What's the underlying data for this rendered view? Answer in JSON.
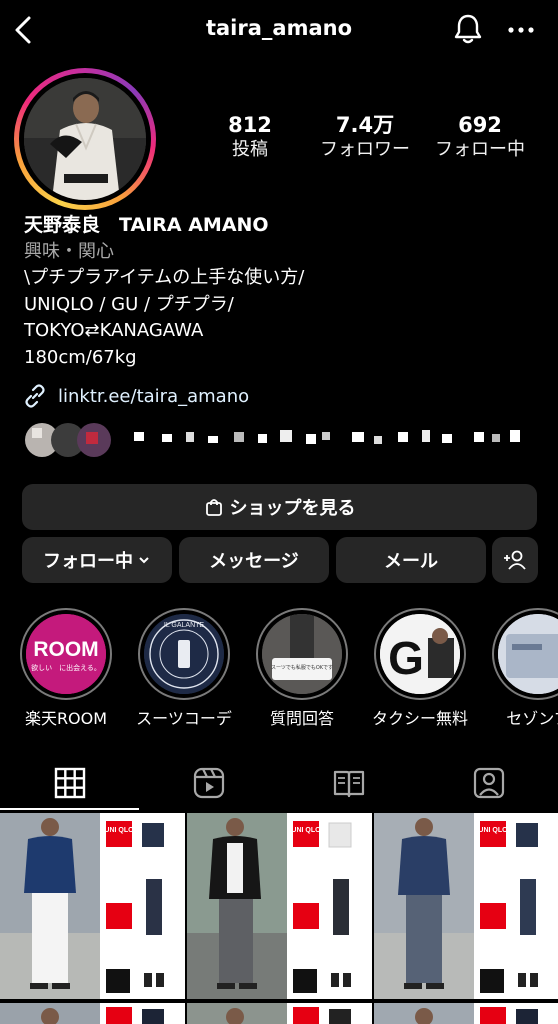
{
  "header": {
    "username": "taira_amano"
  },
  "stats": [
    {
      "num": "812",
      "label": "投稿"
    },
    {
      "num": "7.4万",
      "label": "フォロワー"
    },
    {
      "num": "692",
      "label": "フォロー中"
    }
  ],
  "bio": {
    "name": "天野泰良　TAIRA AMANO",
    "category": "興味・関心",
    "lines": [
      "\\プチプラアイテムの上手な使い方/",
      "UNIQLO / GU / プチプラ/",
      "TOKYO⇄KANAGAWA",
      "180cm/67kg"
    ],
    "link": "linktr.ee/taira_amano"
  },
  "buttons": {
    "shop": "ショップを見る",
    "following": "フォロー中",
    "message": "メッセージ",
    "mail": "メール"
  },
  "highlights": [
    {
      "label": "楽天ROOM",
      "room_text": "ROOM",
      "room_sub": "欲しい　に出会える。"
    },
    {
      "label": "スーツコーデ",
      "badge_text": "IL GALANTE"
    },
    {
      "label": "質問回答",
      "card_text": "スーツでも私服でもOKです"
    },
    {
      "label": "タクシー無料",
      "g_text": "G"
    },
    {
      "label": "セゾンプ"
    }
  ],
  "posts": {
    "brand": "UNI QLO"
  },
  "colors": {
    "background": "#000000",
    "button": "#262626",
    "link": "#e0f1ff",
    "uniqlo_red": "#e60012"
  }
}
